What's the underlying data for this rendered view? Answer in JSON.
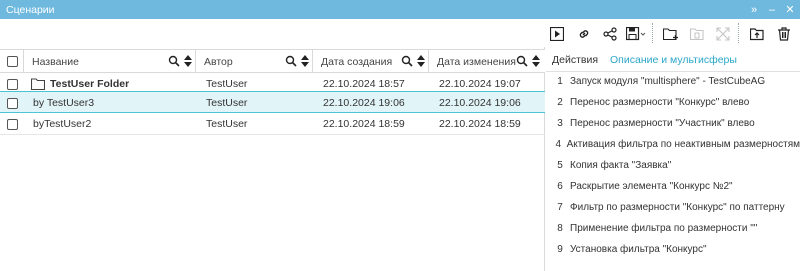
{
  "window": {
    "title": "Сценарии",
    "expand_glyph": "»",
    "minimize_glyph": "–",
    "close_glyph": "✕"
  },
  "toolbar": {
    "icons": [
      "play-icon",
      "link-icon",
      "share-icon",
      "save-icon",
      "new-folder-icon",
      "delete-folder-icon",
      "expand-icon",
      "open-folder-icon",
      "trash-icon"
    ]
  },
  "grid": {
    "columns": [
      {
        "key": "name",
        "label": "Название"
      },
      {
        "key": "author",
        "label": "Автор"
      },
      {
        "key": "created",
        "label": "Дата создания"
      },
      {
        "key": "modified",
        "label": "Дата изменения"
      }
    ],
    "rows": [
      {
        "name": "TestUser Folder",
        "is_folder": true,
        "author": "TestUser",
        "created": "22.10.2024 18:57",
        "modified": "22.10.2024 19:07",
        "selected": false
      },
      {
        "name": "by TestUser3",
        "is_folder": false,
        "author": "TestUser",
        "created": "22.10.2024 19:06",
        "modified": "22.10.2024 19:06",
        "selected": true
      },
      {
        "name": "byTestUser2",
        "is_folder": false,
        "author": "TestUser",
        "created": "22.10.2024 18:59",
        "modified": "22.10.2024 18:59",
        "selected": false
      }
    ]
  },
  "panel": {
    "tabs": [
      {
        "label": "Действия",
        "active": false
      },
      {
        "label": "Описание и мультисферы",
        "active": true
      }
    ],
    "steps": [
      {
        "num": "1",
        "text": "Запуск модуля \"multisphere\" - TestCubeAG"
      },
      {
        "num": "2",
        "text": "Перенос размерности \"Конкурс\" влево"
      },
      {
        "num": "3",
        "text": "Перенос размерности \"Участник\" влево"
      },
      {
        "num": "4",
        "text": "Активация фильтра по неактивным размерностям"
      },
      {
        "num": "5",
        "text": "Копия факта \"Заявка\""
      },
      {
        "num": "6",
        "text": "Раскрытие элемента \"Конкурс №2\""
      },
      {
        "num": "7",
        "text": "Фильтр по размерности \"Конкурс\" по паттерну"
      },
      {
        "num": "8",
        "text": "Применение фильтра по размерности \"\""
      },
      {
        "num": "9",
        "text": "Установка фильтра \"Конкурс\""
      }
    ]
  },
  "colors": {
    "titlebar": "#6fb9df",
    "accent": "#2aa6c8",
    "selected_row": "#e1f4f8",
    "selected_border": "#4fc3d4"
  }
}
